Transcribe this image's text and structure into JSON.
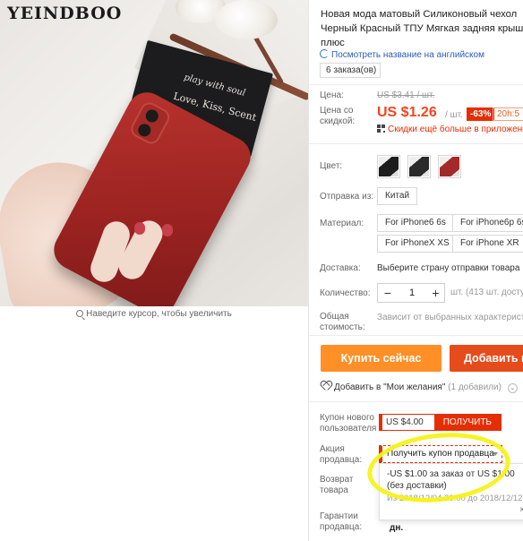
{
  "brand": {
    "logo_text": "YEINDBOO"
  },
  "gallery": {
    "zoom_hint": "Наведите курсор, чтобы увеличить"
  },
  "product": {
    "title_line1": "Новая мода матовый Силиконовый чехол",
    "title_line2": "Черный Красный ТПУ Мягкая задняя крыш",
    "title_line3": "плюс",
    "translate_link": "Посмотреть название на английском",
    "orders": "6 заказа(ов)"
  },
  "price": {
    "label": "Цена:",
    "old": "US $3.41 / шт.",
    "discount_label_1": "Цена со",
    "discount_label_2": "скидкой:",
    "current": "US $1.26",
    "per_unit": "/ шт.",
    "percent_off": "-63%",
    "timer": "20h:5",
    "more_discounts": "Скидки ещё больше в приложени"
  },
  "color": {
    "label": "Цвет:",
    "swatches": [
      "black",
      "black-2",
      "red"
    ]
  },
  "ship_from": {
    "label": "Отправка из:",
    "value": "Китай"
  },
  "material": {
    "label": "Материал:",
    "options": [
      "For iPhone6 6s",
      "For iPhone6p 6sp",
      "For iPhoneX XS",
      "For iPhone XR"
    ]
  },
  "delivery": {
    "label": "Доставка:",
    "value": "Выберите страну отправки товара"
  },
  "quantity": {
    "label": "Количество:",
    "value": "1",
    "minus": "−",
    "plus": "+",
    "note": "шт. (413 шт. доступ"
  },
  "total": {
    "label_1": "Общая",
    "label_2": "стоимость:",
    "value": "Зависит от выбранных характеристи"
  },
  "actions": {
    "buy_now": "Купить сейчас",
    "add_to_cart": "Добавить в",
    "wishlist": "Добавить в \"Мои желания\"",
    "wishlist_count": "(1 добавили)",
    "wishlist_chevron": "⌄"
  },
  "new_user_coupon": {
    "label_1": "Купон нового",
    "label_2": "пользователя",
    "amount": "US $4.00",
    "button": "ПОЛУЧИТЬ"
  },
  "seller_promo": {
    "label_1": "Акция",
    "label_2": "продавца:",
    "button": "Получить купон продавца",
    "offer_line1": "-US $1.00 за заказ от US $1.00",
    "offer_line2": "(без доставки)",
    "offer_dates": "Из 2018/12/04 20:00 до 2018/12/12 2",
    "close": "×"
  },
  "returns": {
    "label_1": "Возврат",
    "label_2": "товара"
  },
  "guarantee": {
    "label_1": "Гарантии",
    "label_2": "продавца:",
    "value_tail": "дн."
  },
  "colors": {
    "accent": "#e62e04",
    "buy_button": "#ff8f26",
    "cart_button": "#e64b1c",
    "price": "#f0461e",
    "link": "#2a5cb8",
    "highlight": "#f6f21a"
  }
}
